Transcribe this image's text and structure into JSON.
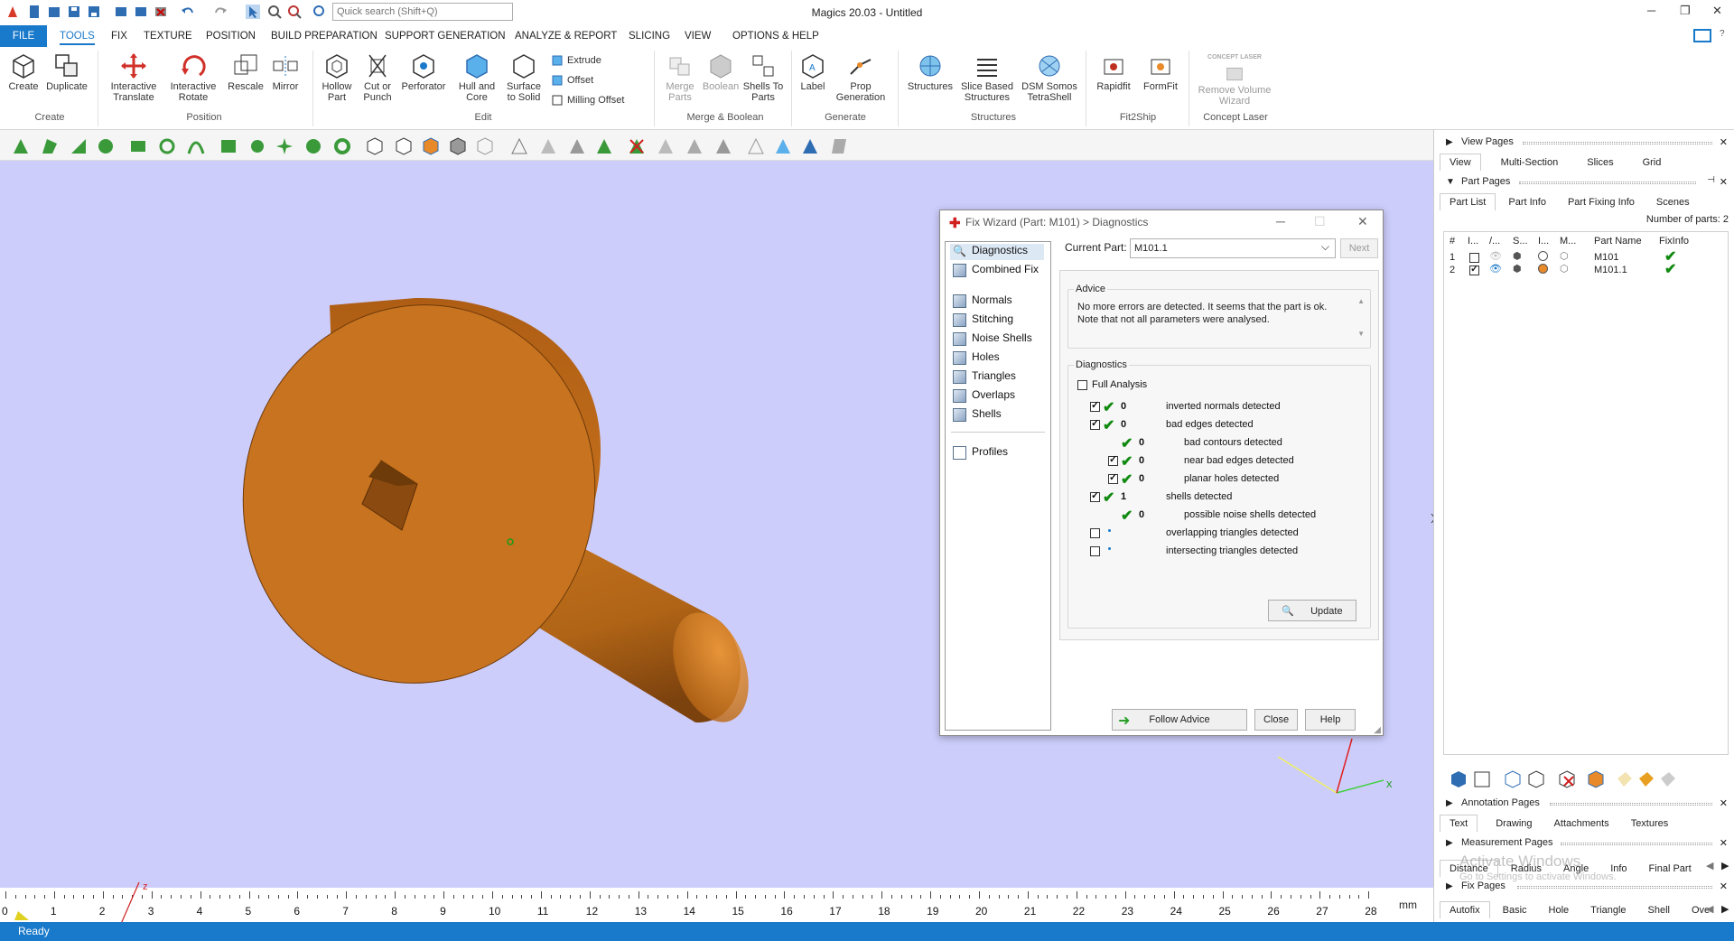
{
  "app": {
    "title": "Magics 20.03 - Untitled",
    "search_placeholder": "Quick search (Shift+Q)"
  },
  "menus": [
    "FILE",
    "TOOLS",
    "FIX",
    "TEXTURE",
    "POSITION",
    "BUILD PREPARATION",
    "SUPPORT GENERATION",
    "ANALYZE & REPORT",
    "SLICING",
    "VIEW",
    "OPTIONS & HELP"
  ],
  "ribbon": {
    "create": {
      "create": "Create",
      "duplicate": "Duplicate",
      "group": "Create"
    },
    "position": {
      "interactive_translate": "Interactive Translate",
      "interactive_rotate": "Interactive Rotate",
      "rescale": "Rescale",
      "mirror": "Mirror",
      "group": "Position"
    },
    "edit": {
      "hollow_part": "Hollow Part",
      "cut_or_punch": "Cut or Punch",
      "perforator": "Perforator",
      "hull_and_core": "Hull and Core",
      "surface_to_solid": "Surface to Solid",
      "extrude": "Extrude",
      "offset": "Offset",
      "milling_offset": "Milling Offset",
      "group": "Edit"
    },
    "merge": {
      "merge_parts": "Merge Parts",
      "boolean": "Boolean",
      "shells_to_parts": "Shells To Parts",
      "group": "Merge & Boolean"
    },
    "generate": {
      "label": "Label",
      "prop_generation": "Prop Generation",
      "group": "Generate"
    },
    "structures": {
      "structures": "Structures",
      "slice_based": "Slice Based Structures",
      "dsm": "DSM Somos TetraShell",
      "group": "Structures"
    },
    "fit2ship": {
      "rapidfit": "Rapidfit",
      "formfit": "FormFit",
      "group": "Fit2Ship"
    },
    "concept": {
      "remove_volume": "Remove Volume Wizard",
      "logo_text": "CONCEPT LASER",
      "group": "Concept Laser"
    }
  },
  "ruler": {
    "labels": [
      "0",
      "1",
      "2",
      "3",
      "4",
      "5",
      "6",
      "7",
      "8",
      "9",
      "10",
      "11",
      "12",
      "13",
      "14",
      "15",
      "16",
      "17",
      "18",
      "19",
      "20",
      "21",
      "22",
      "23",
      "24",
      "25",
      "26",
      "27",
      "28"
    ],
    "unit": "mm",
    "axis_label": "z"
  },
  "axes": {
    "x": "x"
  },
  "status": "Ready",
  "right_panel": {
    "view_pages": {
      "title": "View Pages",
      "tabs": [
        "View",
        "Multi-Section",
        "Slices",
        "Grid"
      ]
    },
    "part_pages": {
      "title": "Part Pages",
      "tabs": [
        "Part List",
        "Part Info",
        "Part Fixing Info",
        "Scenes"
      ],
      "count": "Number of parts: 2",
      "columns": [
        "#",
        "I...",
        "/...",
        "S...",
        "I...",
        "M...",
        "Part Name",
        "FixInfo"
      ],
      "rows": [
        {
          "num": "1",
          "name": "M101",
          "checked": false
        },
        {
          "num": "2",
          "name": "M101.1",
          "checked": true
        }
      ]
    },
    "annotation_pages": {
      "title": "Annotation Pages",
      "tabs": [
        "Text",
        "Drawing",
        "Attachments",
        "Textures"
      ]
    },
    "measurement_pages": {
      "title": "Measurement Pages",
      "tabs": [
        "Distance",
        "Radius",
        "Angle",
        "Info",
        "Final Part"
      ]
    },
    "fix_pages": {
      "title": "Fix Pages",
      "tabs": [
        "Autofix",
        "Basic",
        "Hole",
        "Triangle",
        "Shell",
        "Over"
      ]
    },
    "watermark": {
      "line1": "Activate Windows",
      "line2": "Go to Settings to activate Windows."
    }
  },
  "dialog": {
    "title": "Fix Wizard (Part: M101) > Diagnostics",
    "nav": [
      "Diagnostics",
      "Combined Fix",
      "Normals",
      "Stitching",
      "Noise Shells",
      "Holes",
      "Triangles",
      "Overlaps",
      "Shells",
      "Profiles"
    ],
    "current_part_label": "Current Part:",
    "current_part": "M101.1",
    "next": "Next",
    "advice_label": "Advice",
    "advice_text": "No more errors are detected. It seems that the part is ok. Note that not all parameters were analysed.",
    "diagnostics_label": "Diagnostics",
    "full_analysis": "Full Analysis",
    "items": [
      {
        "count": "0",
        "text": "inverted normals detected",
        "level": 0,
        "checked": true,
        "ok": true
      },
      {
        "count": "0",
        "text": "bad edges detected",
        "level": 0,
        "checked": true,
        "ok": true
      },
      {
        "count": "0",
        "text": "bad contours detected",
        "level": 1,
        "checked": false,
        "ok": true
      },
      {
        "count": "0",
        "text": "near bad edges detected",
        "level": 1,
        "checked": true,
        "ok": true
      },
      {
        "count": "0",
        "text": "planar holes detected",
        "level": 1,
        "checked": true,
        "ok": true
      },
      {
        "count": "1",
        "text": "shells detected",
        "level": 0,
        "checked": true,
        "ok": true
      },
      {
        "count": "0",
        "text": "possible noise shells detected",
        "level": 1,
        "checked": false,
        "ok": true
      },
      {
        "count": "",
        "text": "overlapping triangles detected",
        "level": 0,
        "checked": false,
        "ok": false
      },
      {
        "count": "",
        "text": "intersecting triangles detected",
        "level": 0,
        "checked": false,
        "ok": false
      }
    ],
    "update": "Update",
    "follow_advice": "Follow Advice",
    "close": "Close",
    "help": "Help"
  },
  "colors": {
    "accent": "#1979ca",
    "viewport": "#cdcdfb",
    "part": "#c86f1e",
    "check": "#118a11"
  }
}
